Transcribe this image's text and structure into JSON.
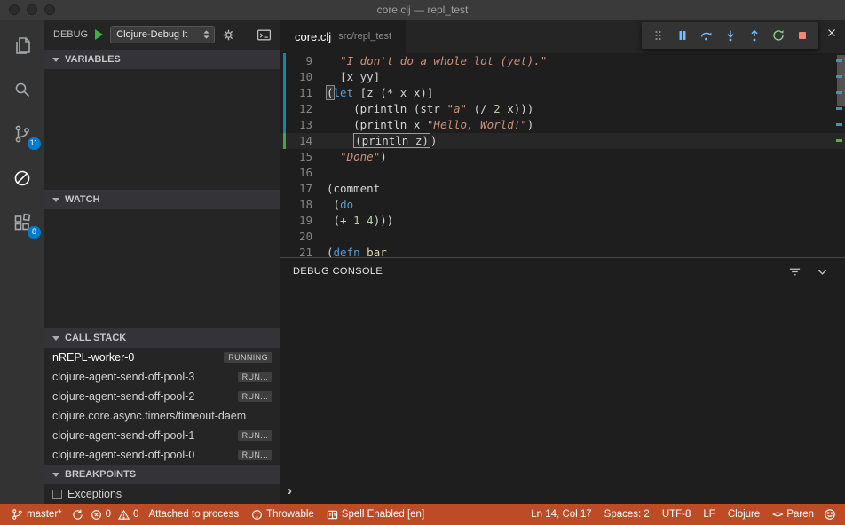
{
  "colors": {
    "status_bar_bg": "#BC4B26",
    "accent_blue": "#007acc",
    "play_green": "#3fae49",
    "restart_green": "#89d185",
    "stop_red": "#f48771",
    "step_blue": "#75beff",
    "string_orange": "#ce9178",
    "keyword_blue": "#569cd6",
    "number_green": "#b5cea8",
    "function_yellow": "#dcdcaa"
  },
  "title_bar": {
    "title": "core.clj — repl_test"
  },
  "activity_bar": {
    "items": [
      {
        "name": "explorer",
        "badge": ""
      },
      {
        "name": "search",
        "badge": ""
      },
      {
        "name": "source-control",
        "badge": "11"
      },
      {
        "name": "debug",
        "badge": ""
      },
      {
        "name": "extensions",
        "badge": "8"
      }
    ]
  },
  "debug_sidebar": {
    "toolbar": {
      "label": "DEBUG",
      "config_name": "Clojure-Debug It",
      "icons": [
        "start",
        "configuration-select",
        "gear",
        "open-console"
      ]
    },
    "sections": {
      "variables": "VARIABLES",
      "watch": "WATCH",
      "call_stack": "CALL STACK",
      "breakpoints": "BREAKPOINTS"
    },
    "call_stack_items": [
      {
        "label": "nREPL-worker-0",
        "badge": "RUNNING"
      },
      {
        "label": "clojure-agent-send-off-pool-3",
        "badge": "RUN..."
      },
      {
        "label": "clojure-agent-send-off-pool-2",
        "badge": "RUN..."
      },
      {
        "label": "clojure.core.async.timers/timeout-daem",
        "badge": ""
      },
      {
        "label": "clojure-agent-send-off-pool-1",
        "badge": "RUN..."
      },
      {
        "label": "clojure-agent-send-off-pool-0",
        "badge": "RUN..."
      }
    ],
    "breakpoints": [
      {
        "label": "Exceptions",
        "checked": false
      }
    ]
  },
  "editor": {
    "tab": {
      "file": "core.clj",
      "path": "src/repl_test"
    },
    "debug_toolbar_icons": [
      "drag-handle",
      "pause",
      "step-over",
      "step-into",
      "step-out",
      "restart",
      "stop"
    ],
    "lines": [
      {
        "num": 9,
        "gutter": "mod",
        "tokens": [
          {
            "t": "  ",
            "c": "plain"
          },
          {
            "t": "\"I don't do a whole lot (yet).\"",
            "c": "string"
          }
        ]
      },
      {
        "num": 10,
        "gutter": "mod",
        "tokens": [
          {
            "t": "  [x yy]",
            "c": "plain"
          }
        ]
      },
      {
        "num": 11,
        "gutter": "mod",
        "tokens": [
          {
            "t": "(",
            "c": "paren"
          },
          {
            "t": "let",
            "c": "keyword"
          },
          {
            "t": " [z (* x x)]",
            "c": "plain"
          }
        ]
      },
      {
        "num": 12,
        "gutter": "mod",
        "tokens": [
          {
            "t": "    (println (str ",
            "c": "plain"
          },
          {
            "t": "\"a\"",
            "c": "string"
          },
          {
            "t": " (/ ",
            "c": "plain"
          },
          {
            "t": "2",
            "c": "number"
          },
          {
            "t": " x)))",
            "c": "plain"
          }
        ]
      },
      {
        "num": 13,
        "gutter": "mod",
        "tokens": [
          {
            "t": "    (println x ",
            "c": "plain"
          },
          {
            "t": "\"Hello, World!\"",
            "c": "string"
          },
          {
            "t": ")",
            "c": "plain"
          }
        ]
      },
      {
        "num": 14,
        "gutter": "add",
        "current": true,
        "tokens": [
          {
            "t": "    ",
            "c": "plain"
          },
          {
            "t": "(println z)",
            "c": "debug"
          },
          {
            "t": ")",
            "c": "plain"
          }
        ]
      },
      {
        "num": 15,
        "tokens": [
          {
            "t": "  ",
            "c": "plain"
          },
          {
            "t": "\"Done\"",
            "c": "string"
          },
          {
            "t": ")",
            "c": "plain"
          }
        ]
      },
      {
        "num": 16,
        "tokens": []
      },
      {
        "num": 17,
        "tokens": [
          {
            "t": "(comment",
            "c": "plain"
          }
        ]
      },
      {
        "num": 18,
        "tokens": [
          {
            "t": " (",
            "c": "plain"
          },
          {
            "t": "do",
            "c": "keyword"
          }
        ]
      },
      {
        "num": 19,
        "tokens": [
          {
            "t": " (+ ",
            "c": "plain"
          },
          {
            "t": "1",
            "c": "number"
          },
          {
            "t": " ",
            "c": "plain"
          },
          {
            "t": "4",
            "c": "number"
          },
          {
            "t": ")))",
            "c": "plain"
          }
        ]
      },
      {
        "num": 20,
        "tokens": []
      },
      {
        "num": 21,
        "tokens": [
          {
            "t": "(",
            "c": "plain"
          },
          {
            "t": "defn",
            "c": "keyword"
          },
          {
            "t": " ",
            "c": "plain"
          },
          {
            "t": "bar",
            "c": "function"
          }
        ]
      }
    ]
  },
  "debug_console": {
    "title": "DEBUG CONSOLE",
    "prompt": "›",
    "icons": [
      "filter",
      "collapse-chevron"
    ]
  },
  "status_bar": {
    "left": [
      {
        "icon": "git-branch",
        "label": "master*"
      },
      {
        "icon": "sync",
        "label": ""
      },
      {
        "icon": "error",
        "label": "0"
      },
      {
        "icon": "warning",
        "label": "0"
      },
      {
        "icon": "",
        "label": "Attached to process"
      },
      {
        "icon": "alert",
        "label": "Throwable"
      },
      {
        "icon": "spell",
        "label": "Spell Enabled [en]"
      }
    ],
    "right": [
      {
        "label": "Ln 14, Col 17"
      },
      {
        "label": "Spaces: 2"
      },
      {
        "label": "UTF-8"
      },
      {
        "label": "LF"
      },
      {
        "label": "Clojure"
      },
      {
        "icon_text": "<>",
        "label": "Paren"
      },
      {
        "icon": "smiley",
        "label": ""
      }
    ]
  }
}
